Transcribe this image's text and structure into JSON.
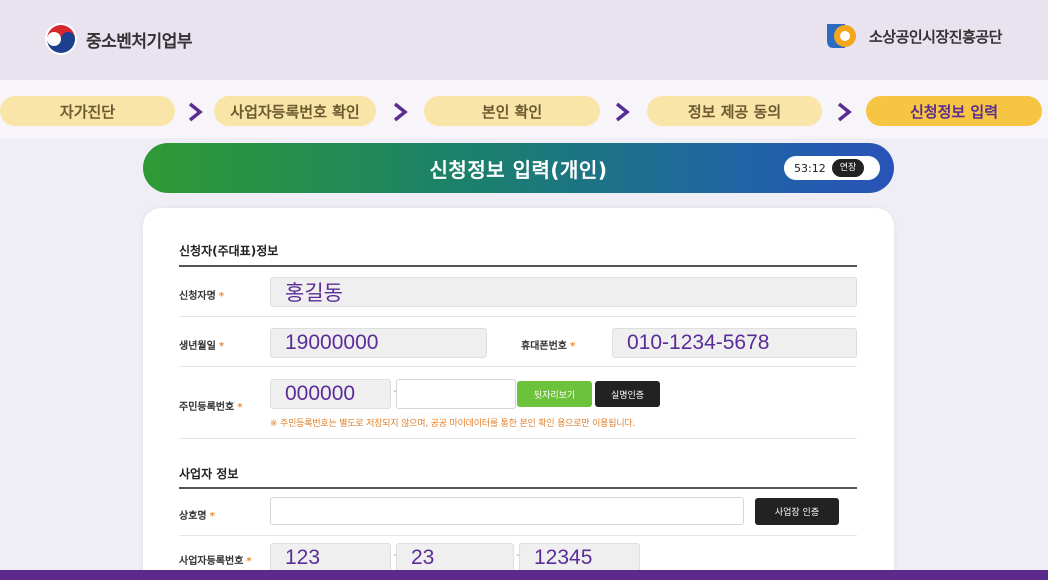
{
  "header": {
    "left_logo_text": "중소벤처기업부",
    "right_logo_text": "소상공인시장진흥공단"
  },
  "steps": [
    {
      "label": "자가진단",
      "active": false
    },
    {
      "label": "사업자등록번호 확인",
      "active": false
    },
    {
      "label": "본인 확인",
      "active": false
    },
    {
      "label": "정보 제공 동의",
      "active": false
    },
    {
      "label": "신청정보 입력",
      "active": true
    }
  ],
  "title_bar": {
    "title": "신청정보 입력(개인)",
    "timer": "53:12",
    "extend_label": "연장"
  },
  "applicant": {
    "section_title": "신청자(주대표)정보",
    "name_label": "신청자명",
    "name_value": "홍길동",
    "birth_label": "생년월일",
    "birth_value": "19000000",
    "phone_label": "휴대폰번호",
    "phone_value": "010-1234-5678",
    "rrn_label": "주민등록번호",
    "rrn_front": "000000",
    "rrn_back": "",
    "rrn_dash": "-",
    "show_back_button": "뒷자리보기",
    "verify_button": "실명인증",
    "notice": "※ 주민등록번호는 별도로 저장되지 않으며, 공공 마이데이터를 통한 본인 확인 용으로만 이용됩니다."
  },
  "business": {
    "section_title": "사업자 정보",
    "company_label": "상호명",
    "company_value": "",
    "company_verify_button": "사업장 인증",
    "brn_label": "사업자등록번호",
    "brn_1": "123",
    "brn_2": "23",
    "brn_3": "12345",
    "dash": "-"
  },
  "colors": {
    "accent_purple": "#5b2c99",
    "step_inactive": "#fae5a8",
    "step_active": "#f6c542",
    "required_mark": "#f08a2c"
  }
}
